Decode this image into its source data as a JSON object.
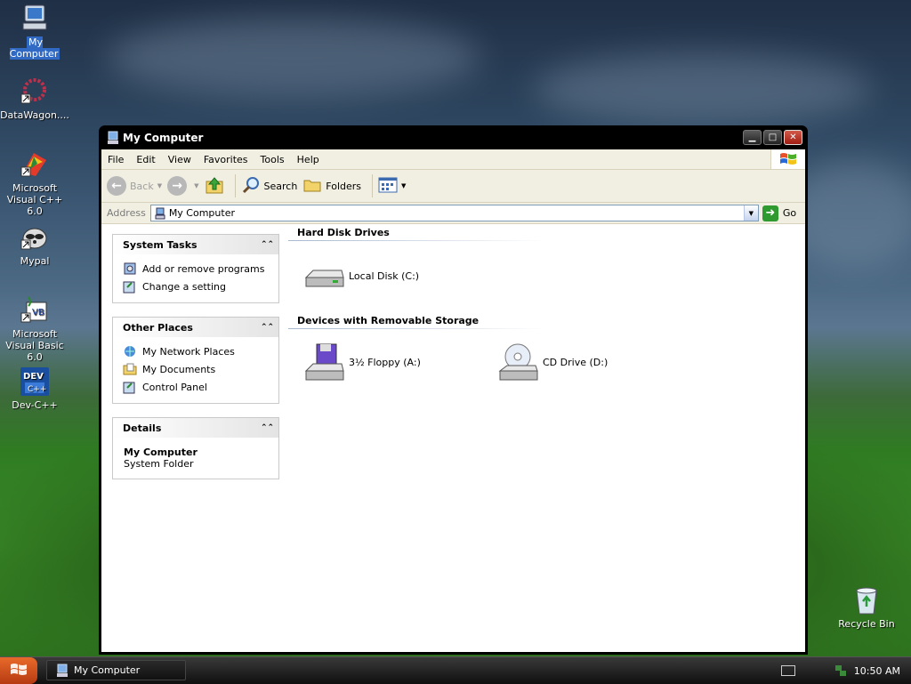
{
  "desktop": {
    "icons": [
      {
        "label": "My Computer",
        "icon": "my-computer-icon"
      },
      {
        "label": "DataWagon....",
        "icon": "datawagon-icon"
      },
      {
        "label": "Microsoft Visual C++ 6.0",
        "icon": "visual-cpp-icon"
      },
      {
        "label": "Mypal",
        "icon": "mypal-icon"
      },
      {
        "label": "Microsoft Visual Basic 6.0",
        "icon": "visual-basic-icon"
      },
      {
        "label": "Dev-C++",
        "icon": "dev-cpp-icon"
      },
      {
        "label": "Recycle Bin",
        "icon": "recycle-bin-icon"
      }
    ]
  },
  "window": {
    "title": "My Computer",
    "menu": [
      "File",
      "Edit",
      "View",
      "Favorites",
      "Tools",
      "Help"
    ],
    "toolbar": {
      "back": "Back",
      "search": "Search",
      "folders": "Folders"
    },
    "address": {
      "label": "Address",
      "value": "My Computer",
      "go": "Go"
    },
    "tasks": {
      "system_tasks": {
        "title": "System Tasks",
        "items": [
          "Add or remove programs",
          "Change a setting"
        ]
      },
      "other_places": {
        "title": "Other Places",
        "items": [
          "My Network Places",
          "My Documents",
          "Control Panel"
        ]
      },
      "details": {
        "title": "Details",
        "name": "My Computer",
        "type": "System Folder"
      }
    },
    "sections": {
      "hard_disks": {
        "title": "Hard Disk Drives",
        "items": [
          "Local Disk (C:)"
        ]
      },
      "removable": {
        "title": "Devices with Removable Storage",
        "items": [
          "3½ Floppy (A:)",
          "CD Drive (D:)"
        ]
      }
    }
  },
  "taskbar": {
    "task": "My Computer",
    "clock": "10:50 AM"
  },
  "colors": {
    "title_bar": "#000000",
    "selection": "#316ac5",
    "go_green": "#2f9a2f"
  }
}
